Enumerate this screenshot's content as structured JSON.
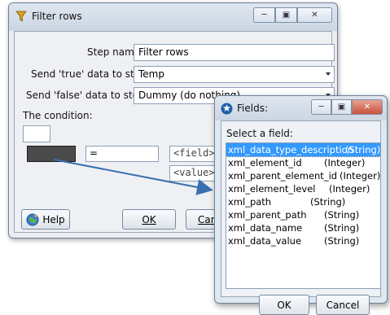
{
  "main_dialog": {
    "title": "Filter rows",
    "step_name_label": "Step name",
    "step_name_value": "Filter rows",
    "send_true_label": "Send 'true' data to step:",
    "send_true_value": "Temp",
    "send_false_label": "Send 'false' data to step:",
    "send_false_value": "Dummy (do nothing)",
    "condition_label": "The condition:",
    "operator_value": "=",
    "field_placeholder": "<field>",
    "value_placeholder": "<value>",
    "help_label": "Help",
    "ok_label": "OK",
    "cancel_label": "Cancel"
  },
  "fields_dialog": {
    "title": "Fields:",
    "select_label": "Select a field:",
    "ok_label": "OK",
    "cancel_label": "Cancel",
    "items": [
      {
        "name": "xml_data_type_description",
        "type": "(String)",
        "selected": true
      },
      {
        "name": "xml_element_id",
        "type": "(Integer)"
      },
      {
        "name": "xml_parent_element_id",
        "type": "(Integer)"
      },
      {
        "name": "xml_element_level",
        "type": "(Integer)"
      },
      {
        "name": "xml_path",
        "type": "(String)"
      },
      {
        "name": "xml_parent_path",
        "type": "(String)"
      },
      {
        "name": "xml_data_name",
        "type": "(String)"
      },
      {
        "name": "xml_data_value",
        "type": "(String)"
      }
    ]
  },
  "colors": {
    "selection": "#3399ff",
    "arrow": "#3a6fb0",
    "close_button": "#c9503c"
  },
  "icons": {
    "filter": "filter-funnel-icon",
    "help": "help-globe-icon",
    "fields": "fields-gear-icon"
  }
}
